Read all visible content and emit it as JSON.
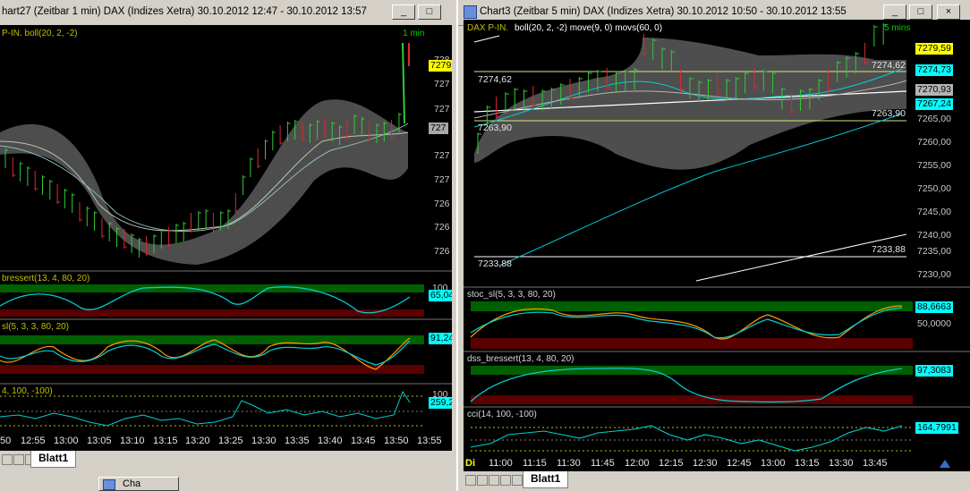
{
  "left": {
    "title": "hart27 (Zeitbar 1 min)  DAX (Indizes Xetra) 30.10.2012 12:47 - 30.10.2012 13:57",
    "main_legend": "P-IN. boll(20, 2, -2)",
    "interval": "1 min",
    "price_box": "7279",
    "prices": [
      "728",
      "727",
      "727",
      "727",
      "727",
      "726",
      "726",
      "726"
    ],
    "gray_box": "727",
    "ind1_legend": "bressert(13, 4, 80, 20)",
    "ind1_top": "100",
    "ind1_value": "65,04",
    "ind2_legend": "sl(5, 3, 3, 80, 20)",
    "ind2_value": "91,24",
    "ind3_legend": "4, 100, -100)",
    "ind3_top": "100",
    "ind3_value": "259,2",
    "times": [
      "50",
      "12:55",
      "13:00",
      "13:05",
      "13:10",
      "13:15",
      "13:20",
      "13:25",
      "13:30",
      "13:35",
      "13:40",
      "13:45",
      "13:50",
      "13:55"
    ],
    "tab": "Blatt1"
  },
  "right": {
    "title": "Chart3 (Zeitbar 5 min)  DAX (Indizes Xetra) 30.10.2012 10:50 - 30.10.2012 13:55",
    "main_legend": "DAX P-IN.",
    "main_legend2": "boll(20, 2, -2) move(9, 0) movs(60, 0)",
    "interval": "5 mins",
    "boxes": [
      {
        "label": "7279,59",
        "color": "#ffff00"
      },
      {
        "label": "7274,73",
        "color": "#00ffff"
      },
      {
        "label": "7270,93",
        "color": "#b4b4b4"
      },
      {
        "label": "7267,24",
        "color": "#00ffff"
      }
    ],
    "prices": [
      "7265,00",
      "7260,00",
      "7255,00",
      "7250,00",
      "7245,00",
      "7240,00",
      "7235,00",
      "7230,00"
    ],
    "line_labels": {
      "a": "7274,62",
      "b": "7274,62",
      "c": "7263,90",
      "d": "7263,90",
      "e": "7233,88",
      "f": "7233,88"
    },
    "stoc_legend": "stoc_sl(5, 3, 3, 80, 20)",
    "stoc_value": "88,6663",
    "stoc_mid": "50,0000",
    "dss_legend": "dss_bressert(13, 4, 80, 20)",
    "dss_value": "97,3083",
    "cci_legend": "cci(14, 100, -100)",
    "cci_value": "164,7991",
    "day_label": "Di",
    "times": [
      "11:00",
      "11:15",
      "11:30",
      "11:45",
      "12:00",
      "12:15",
      "12:30",
      "12:45",
      "13:00",
      "13:15",
      "13:30",
      "13:45"
    ],
    "tab": "Blatt1"
  },
  "taskbar": {
    "label": "Cha"
  },
  "buttons": {
    "min": "_",
    "max": "□",
    "close": "×"
  }
}
